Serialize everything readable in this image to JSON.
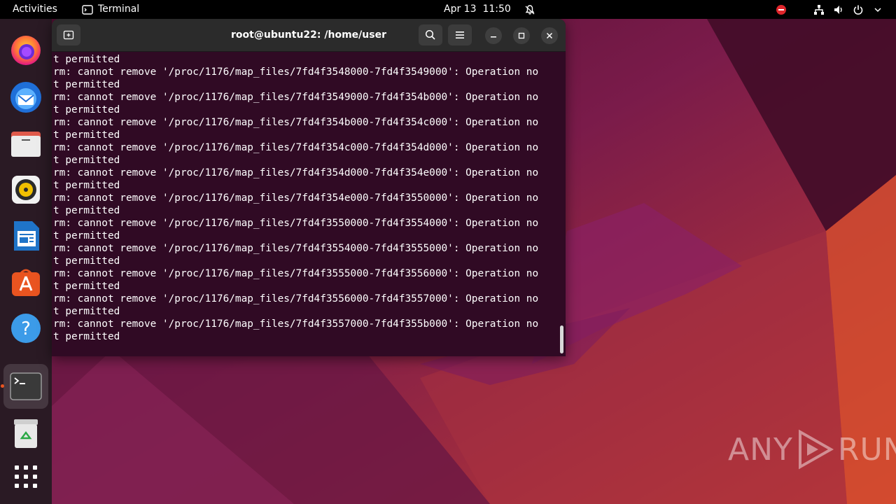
{
  "topbar": {
    "activities": "Activities",
    "app_name": "Terminal",
    "date": "Apr 13",
    "time": "11:50"
  },
  "dock": {
    "items": [
      {
        "name": "firefox"
      },
      {
        "name": "thunderbird"
      },
      {
        "name": "files"
      },
      {
        "name": "rhythmbox"
      },
      {
        "name": "libreoffice-writer"
      },
      {
        "name": "app-center"
      },
      {
        "name": "help"
      },
      {
        "name": "terminal"
      },
      {
        "name": "trash"
      },
      {
        "name": "show-apps"
      }
    ]
  },
  "terminal": {
    "title": "root@ubuntu22: /home/user",
    "lines": [
      "t permitted",
      "rm: cannot remove '/proc/1176/map_files/7fd4f3548000-7fd4f3549000': Operation no",
      "t permitted",
      "rm: cannot remove '/proc/1176/map_files/7fd4f3549000-7fd4f354b000': Operation no",
      "t permitted",
      "rm: cannot remove '/proc/1176/map_files/7fd4f354b000-7fd4f354c000': Operation no",
      "t permitted",
      "rm: cannot remove '/proc/1176/map_files/7fd4f354c000-7fd4f354d000': Operation no",
      "t permitted",
      "rm: cannot remove '/proc/1176/map_files/7fd4f354d000-7fd4f354e000': Operation no",
      "t permitted",
      "rm: cannot remove '/proc/1176/map_files/7fd4f354e000-7fd4f3550000': Operation no",
      "t permitted",
      "rm: cannot remove '/proc/1176/map_files/7fd4f3550000-7fd4f3554000': Operation no",
      "t permitted",
      "rm: cannot remove '/proc/1176/map_files/7fd4f3554000-7fd4f3555000': Operation no",
      "t permitted",
      "rm: cannot remove '/proc/1176/map_files/7fd4f3555000-7fd4f3556000': Operation no",
      "t permitted",
      "rm: cannot remove '/proc/1176/map_files/7fd4f3556000-7fd4f3557000': Operation no",
      "t permitted",
      "rm: cannot remove '/proc/1176/map_files/7fd4f3557000-7fd4f355b000': Operation no",
      "t permitted"
    ]
  },
  "watermark": {
    "left": "ANY",
    "right": "RUN"
  },
  "colors": {
    "terminal_bg": "#300a24",
    "accent": "#e95420"
  }
}
